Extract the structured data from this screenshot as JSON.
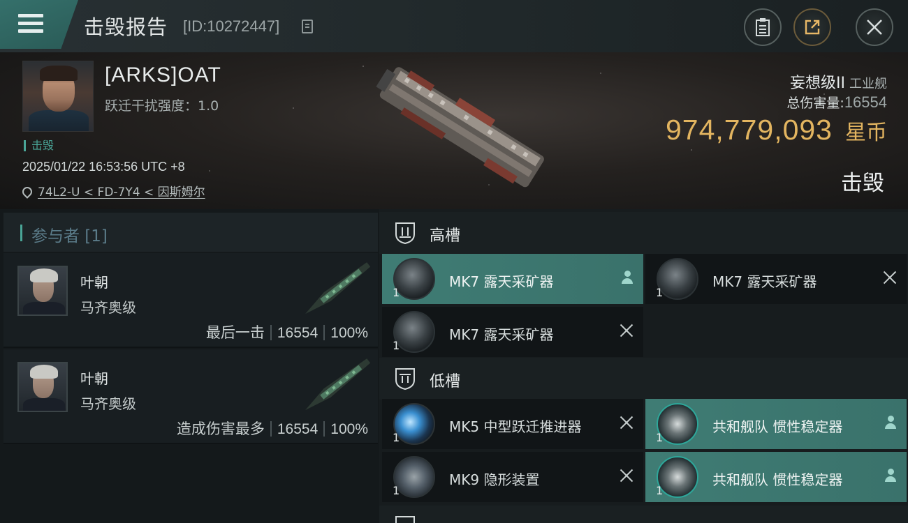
{
  "header": {
    "title": "击毁报告",
    "report_id": "[ID:10272447]",
    "icons": [
      "menu-icon",
      "copy-icon",
      "document-icon",
      "share-icon",
      "close-icon"
    ]
  },
  "victim": {
    "name": "[ARKS]OAT",
    "warp_scramble_label": "跃迁干扰强度：1.0",
    "status": "击毁",
    "datetime": "2025/01/22 16:53:56 UTC +8",
    "location": "74L2-U < FD-7Y4 < 因斯姆尔",
    "ship_name": "妄想级II",
    "ship_type": "工业舰",
    "damage_label": "总伤害量:",
    "damage_value": "16554",
    "isk_value": "974,779,093",
    "isk_unit": "星币",
    "result": "击毁"
  },
  "participants": {
    "header": "参与者 [1]",
    "rows": [
      {
        "name": "叶朝",
        "ship": "马齐奥级",
        "tag": "最后一击",
        "damage": "16554",
        "percent": "100%"
      },
      {
        "name": "叶朝",
        "ship": "马齐奥级",
        "tag": "造成伤害最多",
        "damage": "16554",
        "percent": "100%"
      }
    ]
  },
  "fitting": {
    "high_slot_label": "高槽",
    "low_slot_label": "低槽",
    "high": [
      {
        "qty": "1",
        "name": "MK7 露天采矿器",
        "state": "dropped"
      },
      {
        "qty": "1",
        "name": "MK7 露天采矿器",
        "state": "destroyed"
      },
      {
        "qty": "1",
        "name": "MK7 露天采矿器",
        "state": "destroyed"
      }
    ],
    "low": [
      {
        "qty": "1",
        "name": "MK5 中型跃迁推进器",
        "state": "destroyed"
      },
      {
        "qty": "1",
        "name": "共和舰队 惯性稳定器",
        "state": "dropped"
      },
      {
        "qty": "1",
        "name": "MK9 隐形装置",
        "state": "destroyed"
      },
      {
        "qty": "1",
        "name": "共和舰队 惯性稳定器",
        "state": "dropped"
      }
    ]
  },
  "colors": {
    "accent_teal": "#3f7c74",
    "isk_gold": "#e3b560",
    "status_green": "#4aa597"
  }
}
